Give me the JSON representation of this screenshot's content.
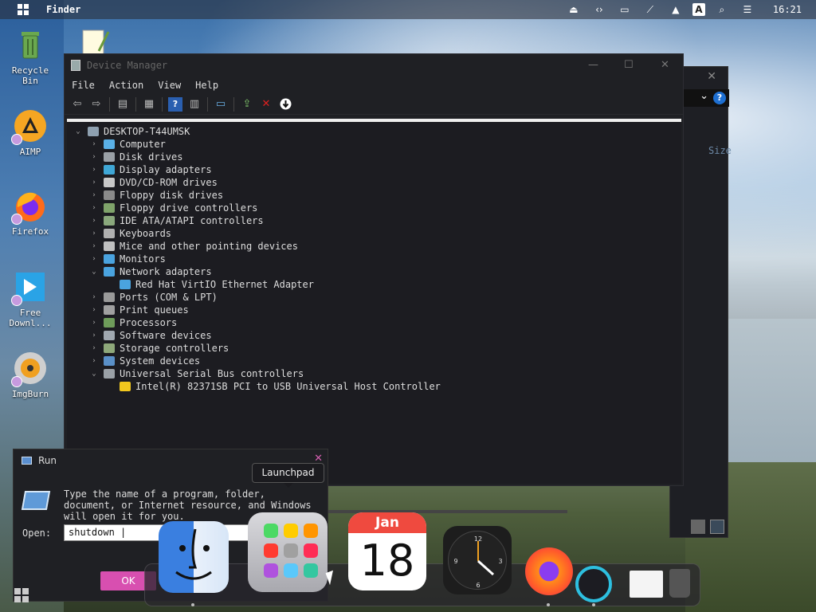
{
  "topbar": {
    "app_name": "Finder",
    "tray_icons": [
      "eject-icon",
      "code-icon",
      "display-icon",
      "network-off-icon",
      "upload-icon",
      "keyboard-layout-icon",
      "search-icon",
      "control-center-icon"
    ],
    "keyboard_layout": "A",
    "time": "16:21"
  },
  "desktop": {
    "icons": [
      {
        "label": "Recycle Bin",
        "icon": "recycle-bin-icon"
      },
      {
        "label": "AIMP",
        "icon": "aimp-icon"
      },
      {
        "label": "Firefox",
        "icon": "firefox-icon"
      },
      {
        "label": "Free Downl...",
        "icon": "free-download-manager-icon"
      },
      {
        "label": "ImgBurn",
        "icon": "imgburn-icon"
      },
      {
        "label": "",
        "icon": "notepad-icon"
      }
    ]
  },
  "back_window": {
    "size_header": "Size"
  },
  "device_manager": {
    "title": "Device Manager",
    "menu": [
      "File",
      "Action",
      "View",
      "Help"
    ],
    "root": "DESKTOP-T44UMSK",
    "categories": [
      {
        "label": "Computer",
        "expanded": false,
        "color": "#5ab0e6"
      },
      {
        "label": "Disk drives",
        "expanded": false,
        "color": "#9aa0a6"
      },
      {
        "label": "Display adapters",
        "expanded": false,
        "color": "#3fa7d6"
      },
      {
        "label": "DVD/CD-ROM drives",
        "expanded": false,
        "color": "#c8c8c8"
      },
      {
        "label": "Floppy disk drives",
        "expanded": false,
        "color": "#8a8a8a"
      },
      {
        "label": "Floppy drive controllers",
        "expanded": false,
        "color": "#7fa36a"
      },
      {
        "label": "IDE ATA/ATAPI controllers",
        "expanded": false,
        "color": "#8aa87c"
      },
      {
        "label": "Keyboards",
        "expanded": false,
        "color": "#b0b0b0"
      },
      {
        "label": "Mice and other pointing devices",
        "expanded": false,
        "color": "#c0c0c0"
      },
      {
        "label": "Monitors",
        "expanded": false,
        "color": "#4aa3df"
      },
      {
        "label": "Network adapters",
        "expanded": true,
        "color": "#4aa3df",
        "children": [
          "Red Hat VirtIO Ethernet Adapter"
        ]
      },
      {
        "label": "Ports (COM & LPT)",
        "expanded": false,
        "color": "#9a9a9a"
      },
      {
        "label": "Print queues",
        "expanded": false,
        "color": "#a0a0a0"
      },
      {
        "label": "Processors",
        "expanded": false,
        "color": "#6e9c5a"
      },
      {
        "label": "Software devices",
        "expanded": false,
        "color": "#a0a8b0"
      },
      {
        "label": "Storage controllers",
        "expanded": false,
        "color": "#8ea87a"
      },
      {
        "label": "System devices",
        "expanded": false,
        "color": "#5a90c8"
      },
      {
        "label": "Universal Serial Bus controllers",
        "expanded": true,
        "color": "#9aa0a6",
        "children": [
          "Intel(R) 82371SB PCI to USB Universal Host Controller"
        ]
      }
    ]
  },
  "run_dialog": {
    "title": "Run",
    "message": "Type the name of a program, folder, document, or Internet resource, and Windows will open it for you.",
    "open_label": "Open:",
    "open_value": "shutdown |",
    "ok_label": "OK"
  },
  "dock": {
    "tooltip": "Launchpad",
    "calendar_month": "Jan",
    "calendar_day": "18",
    "apps": [
      "finder-icon",
      "launchpad-icon",
      "calendar-icon",
      "clock-icon",
      "firefox-icon",
      "vscode-icon",
      "window-thumbnail-icon",
      "trash-icon"
    ]
  },
  "colors": {
    "accent_pink": "#d84fb0",
    "window_bg": "#1f2024",
    "calendar_red": "#ef4a3f"
  }
}
